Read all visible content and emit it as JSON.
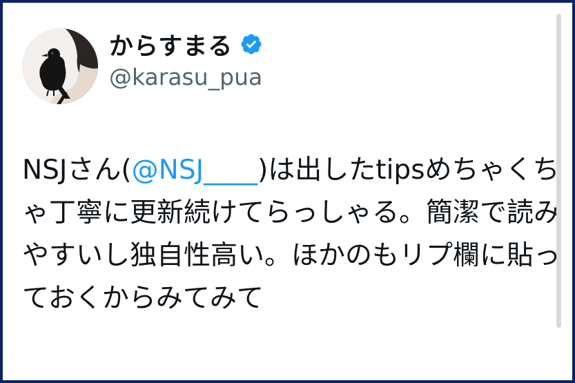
{
  "user": {
    "display_name": "からすまる",
    "handle": "@karasu_pua",
    "verified": true,
    "verified_icon": "verified-badge-icon",
    "avatar_icon": "crow-avatar"
  },
  "tweet": {
    "before_mention": "NSJさん(",
    "mention": "@NSJ____",
    "after_mention": ")は出したtipsめちゃくちゃ丁寧に更新続けてらっしゃる。簡潔で読みやすいし独自性高い。ほかのもリプ欄に貼っておくからみてみて"
  },
  "colors": {
    "frame_border": "#0d2366",
    "mention": "#1d9bf0",
    "verified": "#1d9bf0",
    "text": "#0f1419",
    "handle": "#536471"
  }
}
